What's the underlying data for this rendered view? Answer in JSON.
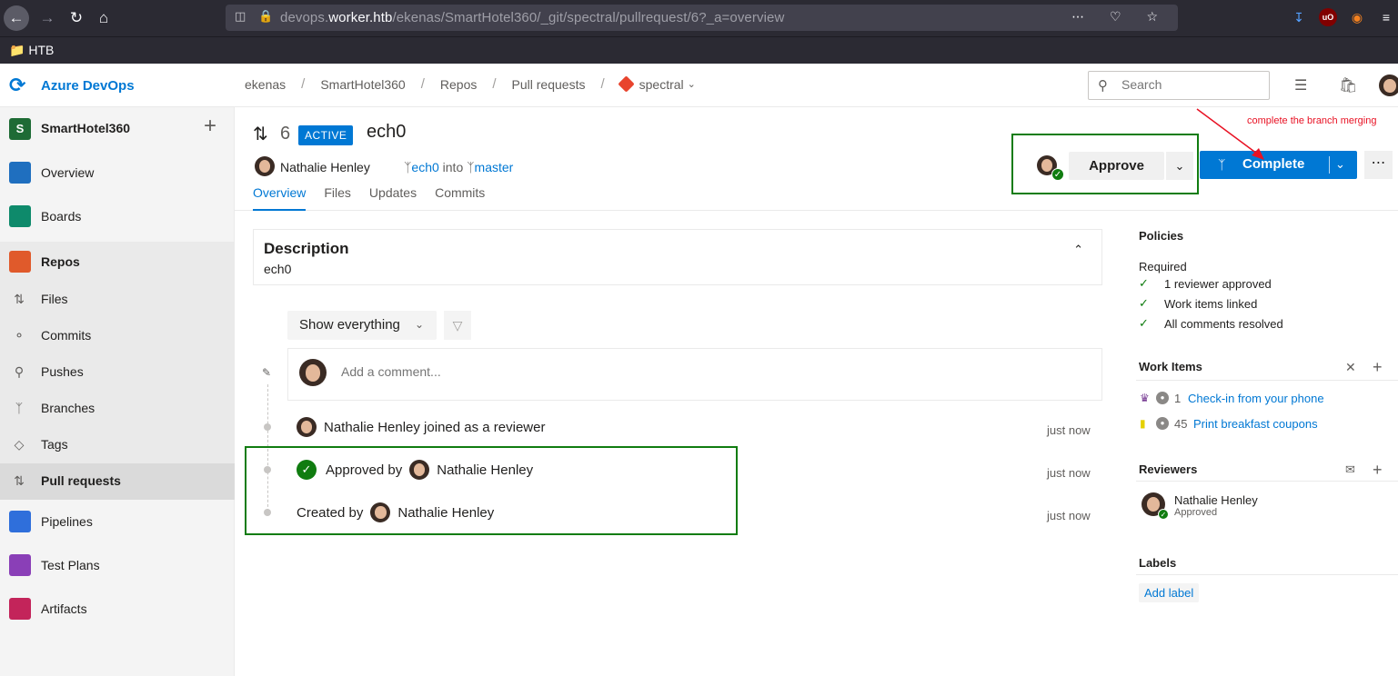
{
  "browser": {
    "url_prefix": "devops.",
    "url_host": "worker.htb",
    "url_path": "/ekenas/SmartHotel360/_git/spectral/pullrequest/6?_a=overview",
    "bookmark": "HTB"
  },
  "app": {
    "brand": "Azure DevOps",
    "breadcrumb": [
      "ekenas",
      "SmartHotel360",
      "Repos",
      "Pull requests",
      "spectral"
    ],
    "search_placeholder": "Search"
  },
  "sidebar": {
    "project_initial": "S",
    "project_name": "SmartHotel360",
    "items": [
      {
        "label": "Overview",
        "color": "#1f6fbf"
      },
      {
        "label": "Boards",
        "color": "#0e8a6b"
      },
      {
        "label": "Repos",
        "color": "#e05a2b"
      }
    ],
    "repo_items": [
      "Files",
      "Commits",
      "Pushes",
      "Branches",
      "Tags",
      "Pull requests"
    ],
    "bottom_items": [
      {
        "label": "Pipelines",
        "color": "#2f6fdb"
      },
      {
        "label": "Test Plans",
        "color": "#8a3fb7"
      },
      {
        "label": "Artifacts",
        "color": "#c3245a"
      }
    ]
  },
  "pr": {
    "number": "6",
    "status": "ACTIVE",
    "title": "ech0",
    "author": "Nathalie Henley",
    "source_branch": "ech0",
    "into": "into",
    "target_branch": "master",
    "tabs": [
      "Overview",
      "Files",
      "Updates",
      "Commits"
    ],
    "approve_label": "Approve",
    "complete_label": "Complete"
  },
  "annotation": "complete the branch merging",
  "description": {
    "title": "Description",
    "body": "ech0"
  },
  "activity": {
    "filter": "Show everything",
    "comment_placeholder": "Add a comment...",
    "events": [
      {
        "text": "Nathalie Henley joined as a reviewer",
        "time": "just now"
      },
      {
        "prefix": "Approved by",
        "name": "Nathalie Henley",
        "time": "just now"
      },
      {
        "prefix": "Created by",
        "name": "Nathalie Henley",
        "time": "just now"
      }
    ]
  },
  "right_panel": {
    "policies_title": "Policies",
    "required_label": "Required",
    "policies": [
      "1 reviewer approved",
      "Work items linked",
      "All comments resolved"
    ],
    "work_items_title": "Work Items",
    "work_items": [
      {
        "id": "1",
        "title": "Check-in from your phone"
      },
      {
        "id": "45",
        "title": "Print breakfast coupons"
      }
    ],
    "reviewers_title": "Reviewers",
    "reviewer_name": "Nathalie Henley",
    "reviewer_status": "Approved",
    "labels_title": "Labels",
    "add_label": "Add label"
  }
}
